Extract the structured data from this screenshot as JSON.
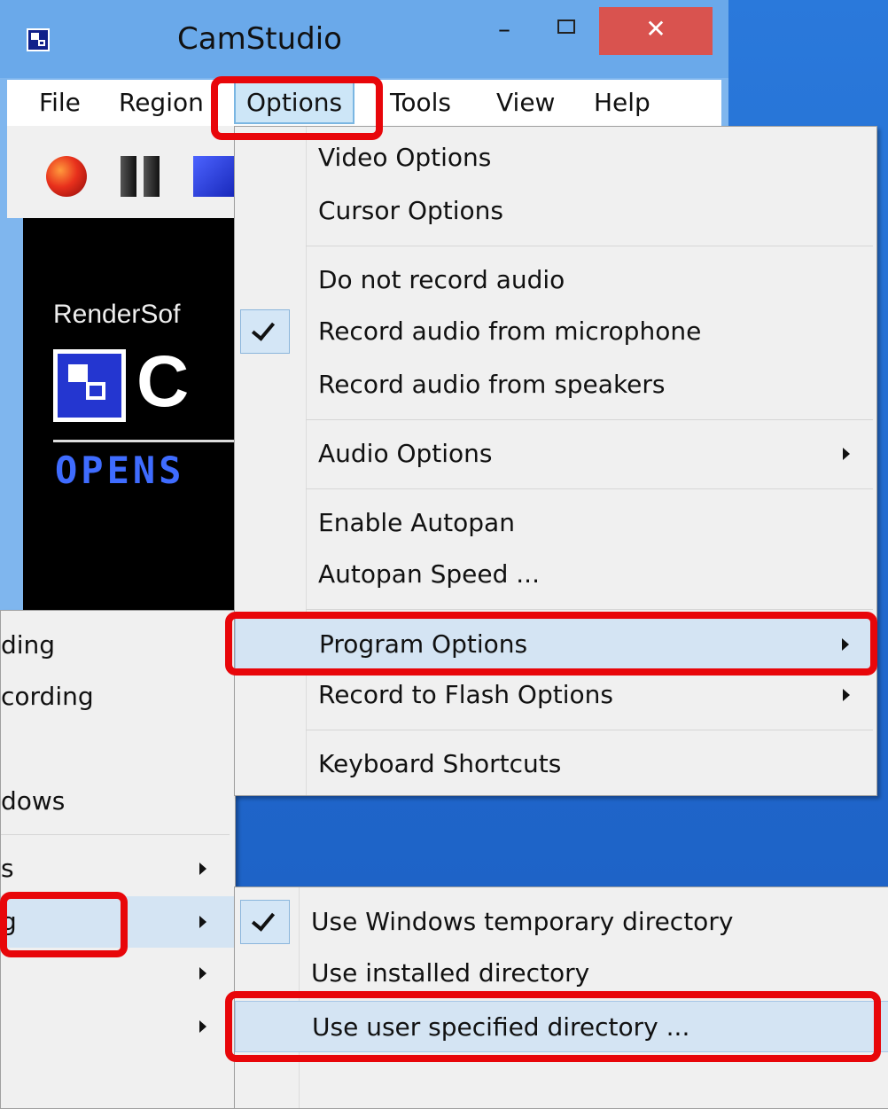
{
  "window": {
    "title": "CamStudio",
    "minimize_glyph": "–",
    "close_glyph": "✕"
  },
  "menubar": {
    "file": "File",
    "region": "Region",
    "options": "Options",
    "tools": "Tools",
    "view": "View",
    "help": "Help"
  },
  "preview": {
    "brand": "RenderSof",
    "big_text": "C",
    "open_text": "OPENS"
  },
  "options_menu": {
    "video_options": "Video Options",
    "cursor_options": "Cursor Options",
    "no_audio": "Do not record audio",
    "audio_mic": "Record audio from microphone",
    "audio_speakers": "Record audio from speakers",
    "audio_options": "Audio Options",
    "enable_autopan": "Enable Autopan",
    "autopan_speed": "Autopan Speed ...",
    "program_options": "Program Options",
    "flash_options": "Record to Flash Options",
    "keyboard_shortcuts": "Keyboard Shortcuts"
  },
  "left_menu": {
    "item1": "ding",
    "item2": "cording",
    "item3": "dows",
    "item4": "s",
    "item5": "g"
  },
  "program_menu": {
    "temp_dir": "Use Windows temporary directory",
    "installed_dir": "Use installed directory",
    "user_dir": "Use user specified directory ..."
  }
}
